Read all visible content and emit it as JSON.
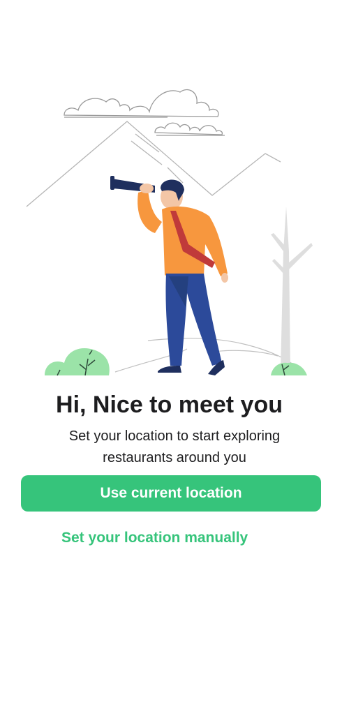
{
  "welcome": {
    "title": "Hi, Nice to meet you",
    "subtitle_line1": "Set your location to start exploring",
    "subtitle_line2": "restaurants around you"
  },
  "actions": {
    "primary_label": "Use current location",
    "secondary_label": "Set your location manually"
  },
  "colors": {
    "accent": "#36c47b",
    "text": "#1d1d1f",
    "shirt": "#f7973e",
    "pants": "#2c4a9a",
    "tie": "#c03a3a",
    "bush": "#9be3a8"
  }
}
